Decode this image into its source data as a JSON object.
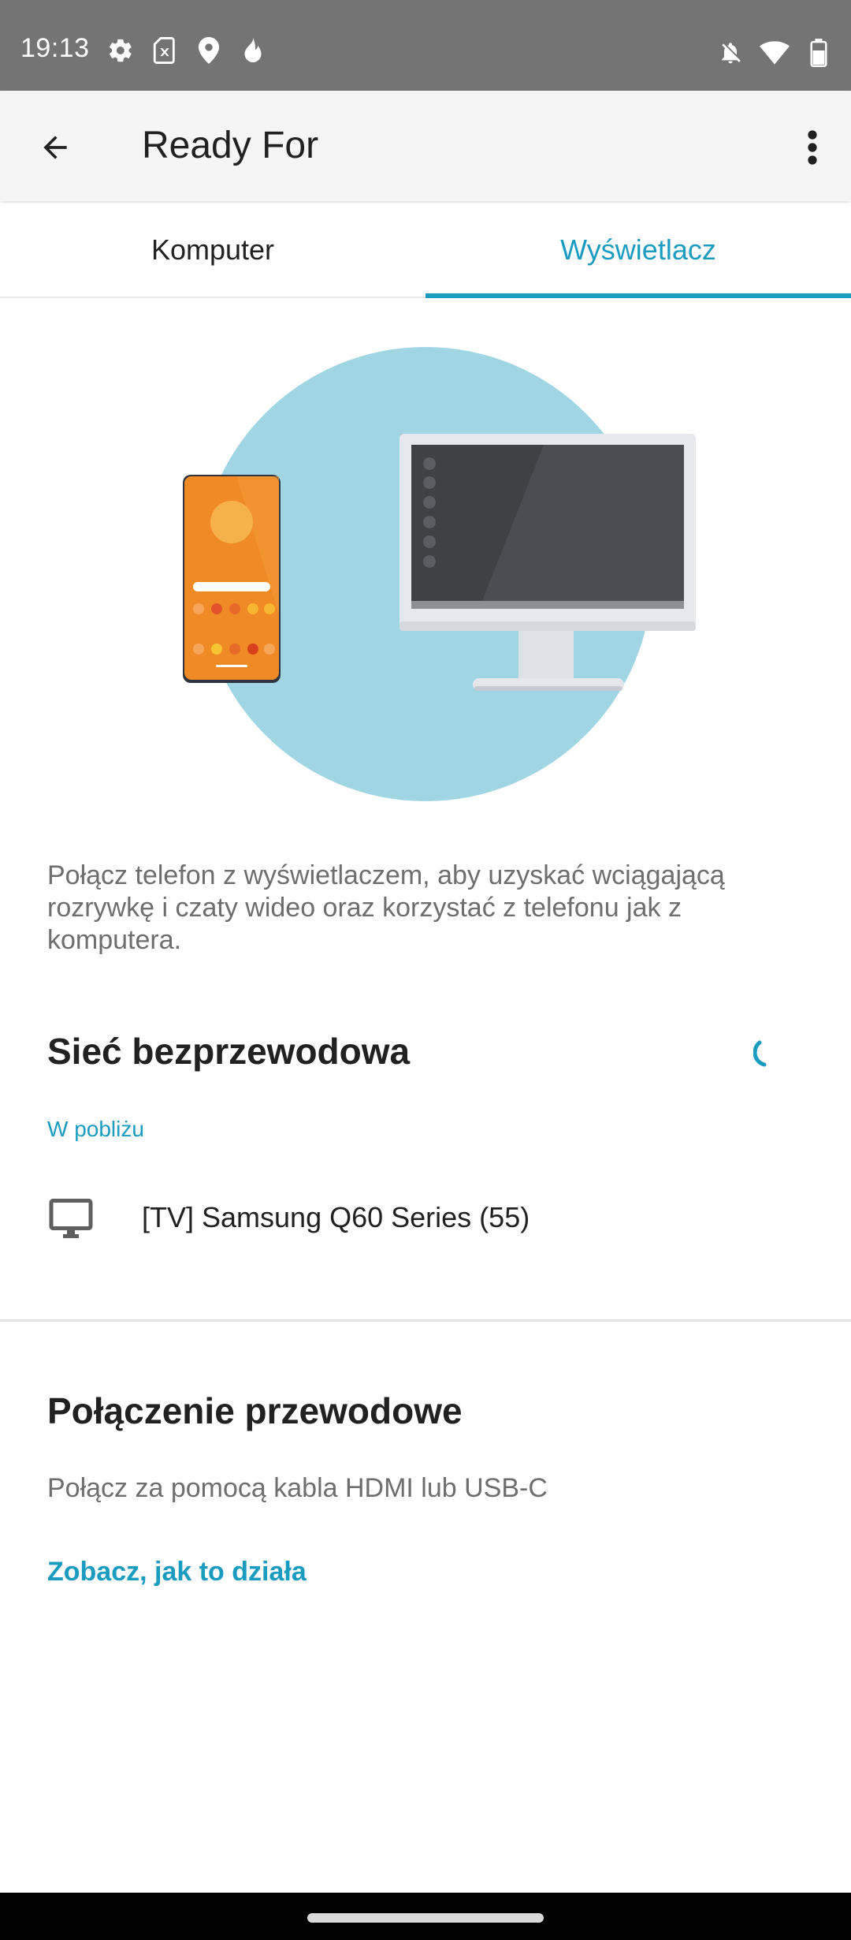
{
  "status_bar": {
    "time": "19:13",
    "left_icons": [
      "settings-icon",
      "sim-card-icon",
      "location-icon",
      "fire-icon"
    ],
    "right_icons": [
      "notifications-off-icon",
      "wifi-icon",
      "battery-icon"
    ]
  },
  "app_bar": {
    "title": "Ready For",
    "back_icon": "arrow-back-icon",
    "menu_icon": "more-vert-icon"
  },
  "tabs": [
    {
      "label": "Komputer",
      "active": false
    },
    {
      "label": "Wyświetlacz",
      "active": true
    }
  ],
  "description": "Połącz telefon z wyświetlaczem, aby uzyskać wciągającą rozrywkę i czaty wideo oraz korzystać z telefonu jak z komputera.",
  "wireless": {
    "title": "Sieć bezprzewodowa",
    "nearby_label": "W pobliżu",
    "devices": [
      {
        "name": "[TV] Samsung Q60 Series (55)",
        "icon": "monitor-icon"
      }
    ]
  },
  "wired": {
    "title": "Połączenie przewodowe",
    "subtitle": "Połącz za pomocą kabla HDMI lub USB-C",
    "link": "Zobacz, jak to działa"
  },
  "colors": {
    "accent": "#1a9bc0",
    "status_bar": "#747474",
    "app_bar": "#f5f5f5",
    "illustration_circle": "#a0d6e3",
    "phone_orange": "#f08a24"
  }
}
